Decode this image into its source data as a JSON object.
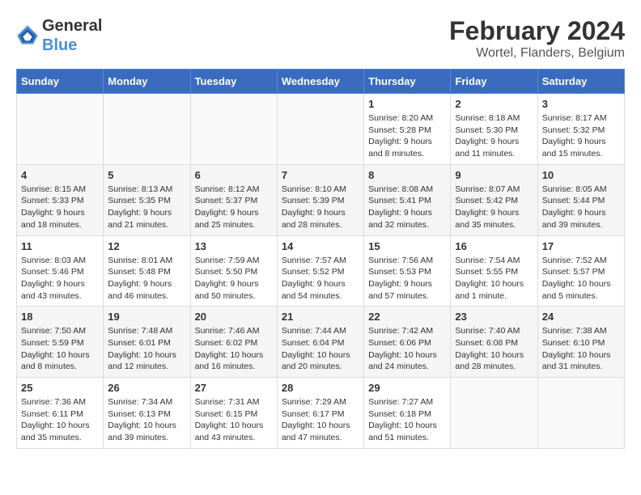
{
  "header": {
    "logo_line1": "General",
    "logo_line2": "Blue",
    "title": "February 2024",
    "subtitle": "Wortel, Flanders, Belgium"
  },
  "weekdays": [
    "Sunday",
    "Monday",
    "Tuesday",
    "Wednesday",
    "Thursday",
    "Friday",
    "Saturday"
  ],
  "weeks": [
    [
      {
        "day": "",
        "info": ""
      },
      {
        "day": "",
        "info": ""
      },
      {
        "day": "",
        "info": ""
      },
      {
        "day": "",
        "info": ""
      },
      {
        "day": "1",
        "info": "Sunrise: 8:20 AM\nSunset: 5:28 PM\nDaylight: 9 hours\nand 8 minutes."
      },
      {
        "day": "2",
        "info": "Sunrise: 8:18 AM\nSunset: 5:30 PM\nDaylight: 9 hours\nand 11 minutes."
      },
      {
        "day": "3",
        "info": "Sunrise: 8:17 AM\nSunset: 5:32 PM\nDaylight: 9 hours\nand 15 minutes."
      }
    ],
    [
      {
        "day": "4",
        "info": "Sunrise: 8:15 AM\nSunset: 5:33 PM\nDaylight: 9 hours\nand 18 minutes."
      },
      {
        "day": "5",
        "info": "Sunrise: 8:13 AM\nSunset: 5:35 PM\nDaylight: 9 hours\nand 21 minutes."
      },
      {
        "day": "6",
        "info": "Sunrise: 8:12 AM\nSunset: 5:37 PM\nDaylight: 9 hours\nand 25 minutes."
      },
      {
        "day": "7",
        "info": "Sunrise: 8:10 AM\nSunset: 5:39 PM\nDaylight: 9 hours\nand 28 minutes."
      },
      {
        "day": "8",
        "info": "Sunrise: 8:08 AM\nSunset: 5:41 PM\nDaylight: 9 hours\nand 32 minutes."
      },
      {
        "day": "9",
        "info": "Sunrise: 8:07 AM\nSunset: 5:42 PM\nDaylight: 9 hours\nand 35 minutes."
      },
      {
        "day": "10",
        "info": "Sunrise: 8:05 AM\nSunset: 5:44 PM\nDaylight: 9 hours\nand 39 minutes."
      }
    ],
    [
      {
        "day": "11",
        "info": "Sunrise: 8:03 AM\nSunset: 5:46 PM\nDaylight: 9 hours\nand 43 minutes."
      },
      {
        "day": "12",
        "info": "Sunrise: 8:01 AM\nSunset: 5:48 PM\nDaylight: 9 hours\nand 46 minutes."
      },
      {
        "day": "13",
        "info": "Sunrise: 7:59 AM\nSunset: 5:50 PM\nDaylight: 9 hours\nand 50 minutes."
      },
      {
        "day": "14",
        "info": "Sunrise: 7:57 AM\nSunset: 5:52 PM\nDaylight: 9 hours\nand 54 minutes."
      },
      {
        "day": "15",
        "info": "Sunrise: 7:56 AM\nSunset: 5:53 PM\nDaylight: 9 hours\nand 57 minutes."
      },
      {
        "day": "16",
        "info": "Sunrise: 7:54 AM\nSunset: 5:55 PM\nDaylight: 10 hours\nand 1 minute."
      },
      {
        "day": "17",
        "info": "Sunrise: 7:52 AM\nSunset: 5:57 PM\nDaylight: 10 hours\nand 5 minutes."
      }
    ],
    [
      {
        "day": "18",
        "info": "Sunrise: 7:50 AM\nSunset: 5:59 PM\nDaylight: 10 hours\nand 8 minutes."
      },
      {
        "day": "19",
        "info": "Sunrise: 7:48 AM\nSunset: 6:01 PM\nDaylight: 10 hours\nand 12 minutes."
      },
      {
        "day": "20",
        "info": "Sunrise: 7:46 AM\nSunset: 6:02 PM\nDaylight: 10 hours\nand 16 minutes."
      },
      {
        "day": "21",
        "info": "Sunrise: 7:44 AM\nSunset: 6:04 PM\nDaylight: 10 hours\nand 20 minutes."
      },
      {
        "day": "22",
        "info": "Sunrise: 7:42 AM\nSunset: 6:06 PM\nDaylight: 10 hours\nand 24 minutes."
      },
      {
        "day": "23",
        "info": "Sunrise: 7:40 AM\nSunset: 6:08 PM\nDaylight: 10 hours\nand 28 minutes."
      },
      {
        "day": "24",
        "info": "Sunrise: 7:38 AM\nSunset: 6:10 PM\nDaylight: 10 hours\nand 31 minutes."
      }
    ],
    [
      {
        "day": "25",
        "info": "Sunrise: 7:36 AM\nSunset: 6:11 PM\nDaylight: 10 hours\nand 35 minutes."
      },
      {
        "day": "26",
        "info": "Sunrise: 7:34 AM\nSunset: 6:13 PM\nDaylight: 10 hours\nand 39 minutes."
      },
      {
        "day": "27",
        "info": "Sunrise: 7:31 AM\nSunset: 6:15 PM\nDaylight: 10 hours\nand 43 minutes."
      },
      {
        "day": "28",
        "info": "Sunrise: 7:29 AM\nSunset: 6:17 PM\nDaylight: 10 hours\nand 47 minutes."
      },
      {
        "day": "29",
        "info": "Sunrise: 7:27 AM\nSunset: 6:18 PM\nDaylight: 10 hours\nand 51 minutes."
      },
      {
        "day": "",
        "info": ""
      },
      {
        "day": "",
        "info": ""
      }
    ]
  ]
}
